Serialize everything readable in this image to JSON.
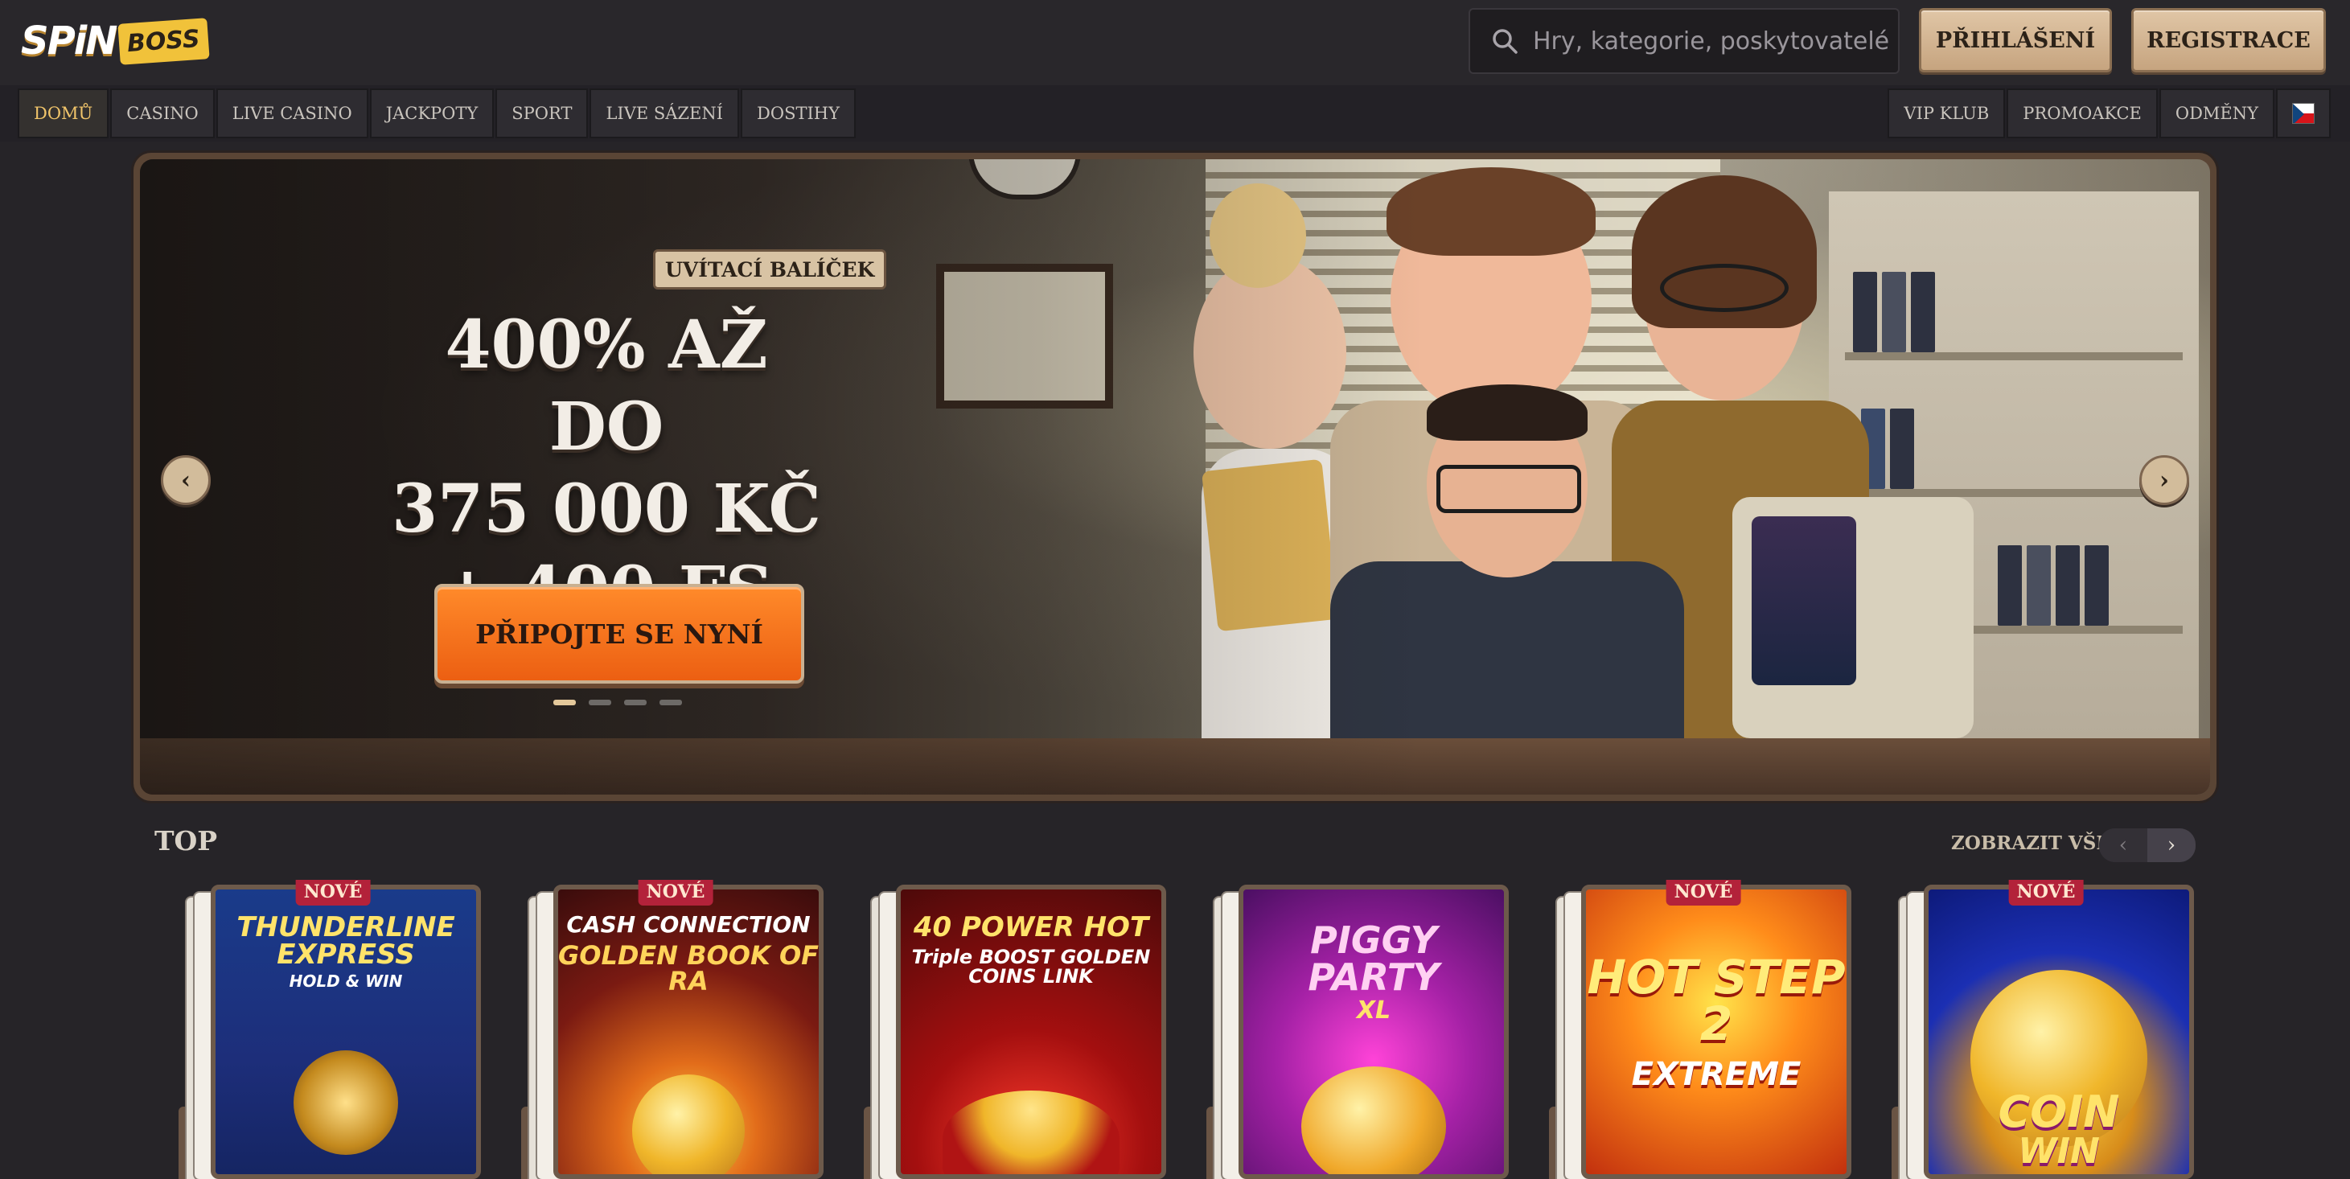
{
  "brand": {
    "logo_spin": "SPiN",
    "logo_boss": "BOSS"
  },
  "search": {
    "placeholder": "Hry, kategorie, poskytovatelé",
    "icon": "search-icon"
  },
  "auth": {
    "login_label": "PŘIHLÁŠENÍ",
    "register_label": "REGISTRACE"
  },
  "nav": {
    "left": [
      {
        "label": "DOMŮ",
        "active": true
      },
      {
        "label": "CASINO"
      },
      {
        "label": "LIVE CASINO"
      },
      {
        "label": "JACKPOTY"
      },
      {
        "label": "SPORT"
      },
      {
        "label": "LIVE SÁZENÍ"
      },
      {
        "label": "DOSTIHY"
      }
    ],
    "right": [
      {
        "label": "VIP KLUB"
      },
      {
        "label": "PROMOAKCE"
      },
      {
        "label": "ODMĚNY"
      }
    ],
    "language_flag": "cz-flag-icon"
  },
  "hero": {
    "badge": "UVÍTACÍ BALÍČEK",
    "title_line1": "400% AŽ DO",
    "title_line2": "375 000 KČ",
    "title_line3": "+ 400 FS",
    "cta": "PŘIPOJTE SE NYNÍ",
    "slides_count": 4,
    "active_slide": 1,
    "prev_arrow": "‹",
    "next_arrow": "›"
  },
  "top_section": {
    "title": "TOP",
    "view_all": "ZOBRAZIT VŠE",
    "prev": "‹",
    "next": "›",
    "badge_label": "NOVÉ",
    "games": [
      {
        "title": "THUNDERLINE EXPRESS",
        "subtitle": "HOLD & WIN",
        "new": true
      },
      {
        "title": "CASH CONNECTION",
        "subtitle": "GOLDEN BOOK OF RA",
        "new": true
      },
      {
        "title": "40 POWER HOT",
        "subtitle": "Triple BOOST GOLDEN COINS LINK",
        "new": false
      },
      {
        "title": "PIGGY PARTY",
        "subtitle": "XL",
        "new": false
      },
      {
        "title": "HOT STEP 2",
        "subtitle": "EXTREME",
        "new": true
      },
      {
        "title": "COIN",
        "subtitle": "WIN",
        "new": true
      }
    ]
  },
  "colors": {
    "background": "#262428",
    "accent_tan": "#d8c3a4",
    "cta_orange": "#f2741e",
    "active_nav": "#f0c46a",
    "new_badge": "#b3223a"
  }
}
